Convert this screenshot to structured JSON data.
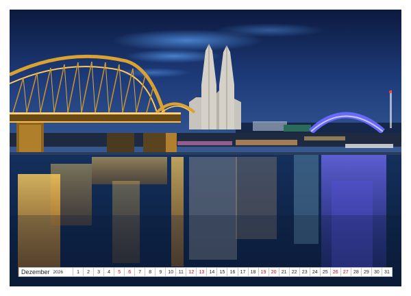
{
  "calendar": {
    "month": "Dezember",
    "year": "2026",
    "colors": {
      "weekday": "#222222",
      "weekend": "#d0021b"
    },
    "days": [
      {
        "n": "1",
        "weekend": false
      },
      {
        "n": "2",
        "weekend": false
      },
      {
        "n": "3",
        "weekend": false
      },
      {
        "n": "4",
        "weekend": false
      },
      {
        "n": "5",
        "weekend": true
      },
      {
        "n": "6",
        "weekend": true
      },
      {
        "n": "7",
        "weekend": false
      },
      {
        "n": "8",
        "weekend": false
      },
      {
        "n": "9",
        "weekend": false
      },
      {
        "n": "10",
        "weekend": false
      },
      {
        "n": "11",
        "weekend": false
      },
      {
        "n": "12",
        "weekend": true
      },
      {
        "n": "13",
        "weekend": true
      },
      {
        "n": "14",
        "weekend": false
      },
      {
        "n": "15",
        "weekend": false
      },
      {
        "n": "16",
        "weekend": false
      },
      {
        "n": "17",
        "weekend": false
      },
      {
        "n": "18",
        "weekend": false
      },
      {
        "n": "19",
        "weekend": true
      },
      {
        "n": "20",
        "weekend": true
      },
      {
        "n": "21",
        "weekend": false
      },
      {
        "n": "22",
        "weekend": false
      },
      {
        "n": "23",
        "weekend": false
      },
      {
        "n": "24",
        "weekend": false
      },
      {
        "n": "25",
        "weekend": false
      },
      {
        "n": "26",
        "weekend": true
      },
      {
        "n": "27",
        "weekend": true
      },
      {
        "n": "28",
        "weekend": false
      },
      {
        "n": "29",
        "weekend": false
      },
      {
        "n": "30",
        "weekend": false
      },
      {
        "n": "31",
        "weekend": false
      }
    ]
  }
}
